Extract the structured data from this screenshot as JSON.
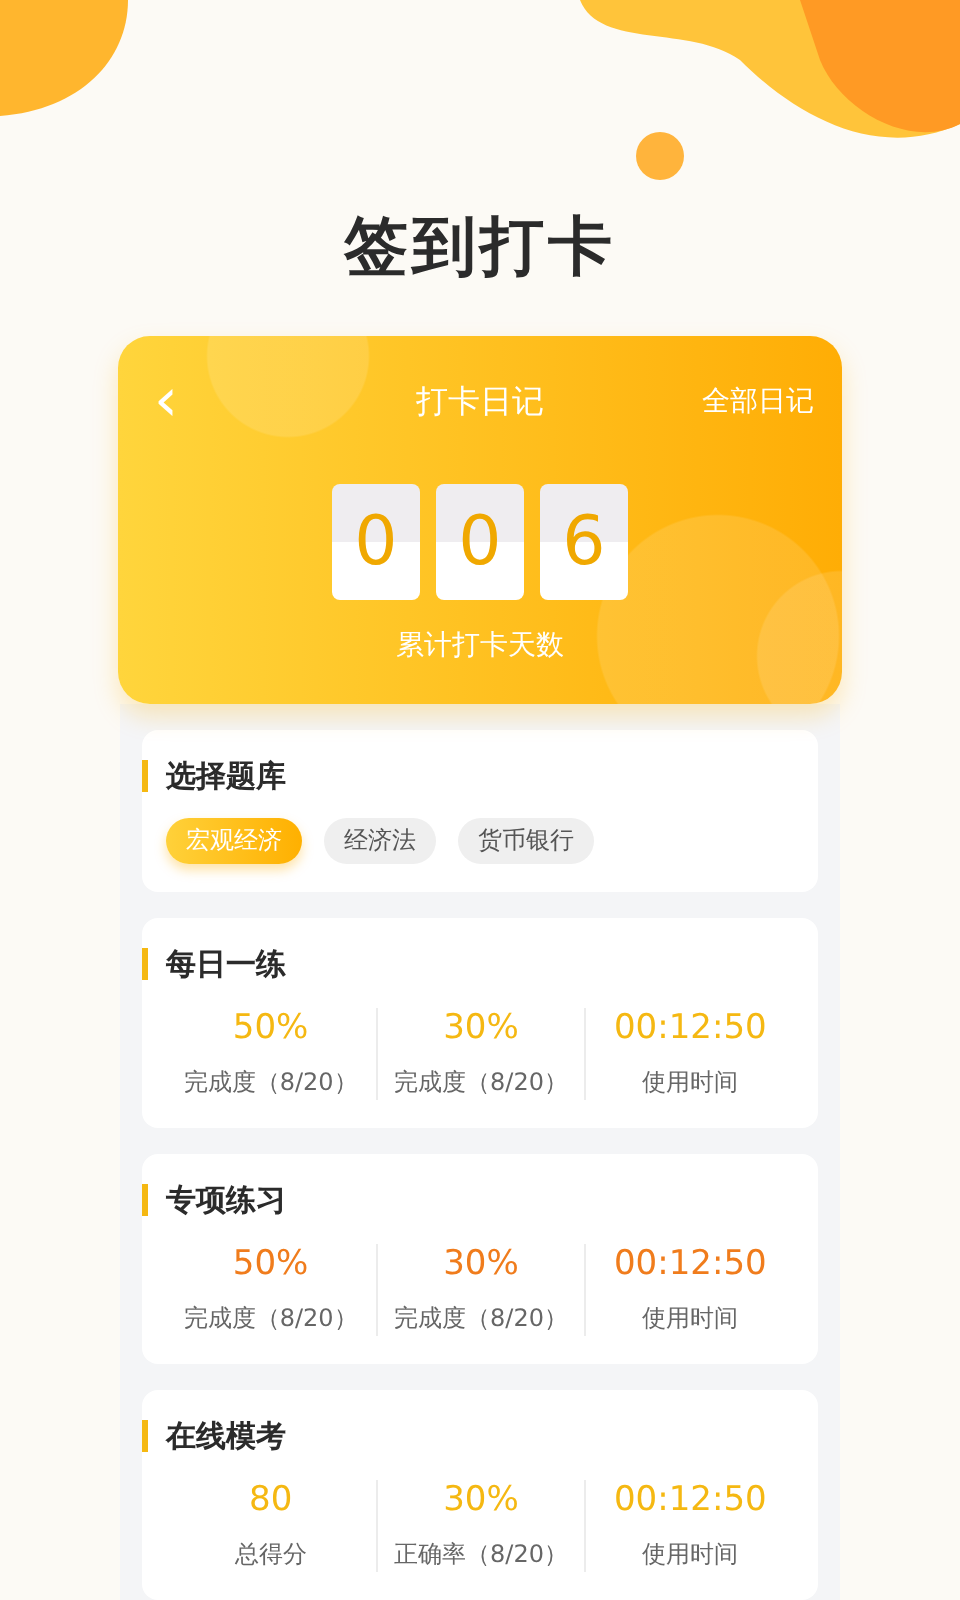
{
  "page_title": "签到打卡",
  "diary_card": {
    "back": "‹",
    "title": "打卡日记",
    "all_link": "全部日记",
    "digits": [
      "0",
      "0",
      "6"
    ],
    "caption": "累计打卡天数"
  },
  "bank": {
    "title": "选择题库",
    "options": [
      {
        "label": "宏观经济",
        "selected": true
      },
      {
        "label": "经济法",
        "selected": false
      },
      {
        "label": "货币银行",
        "selected": false
      }
    ]
  },
  "sections": [
    {
      "title": "每日一练",
      "color": "#f5b812",
      "stats": [
        {
          "value": "50%",
          "label": "完成度（8/20）"
        },
        {
          "value": "30%",
          "label": "完成度（8/20）"
        },
        {
          "value": "00:12:50",
          "label": "使用时间"
        }
      ]
    },
    {
      "title": "专项练习",
      "color": "#f07c1c",
      "stats": [
        {
          "value": "50%",
          "label": "完成度（8/20）"
        },
        {
          "value": "30%",
          "label": "完成度（8/20）"
        },
        {
          "value": "00:12:50",
          "label": "使用时间"
        }
      ]
    },
    {
      "title": "在线模考",
      "color": "#f5b812",
      "stats": [
        {
          "value": "80",
          "label": "总得分"
        },
        {
          "value": "30%",
          "label": "正确率（8/20）"
        },
        {
          "value": "00:12:50",
          "label": "使用时间"
        }
      ]
    }
  ]
}
